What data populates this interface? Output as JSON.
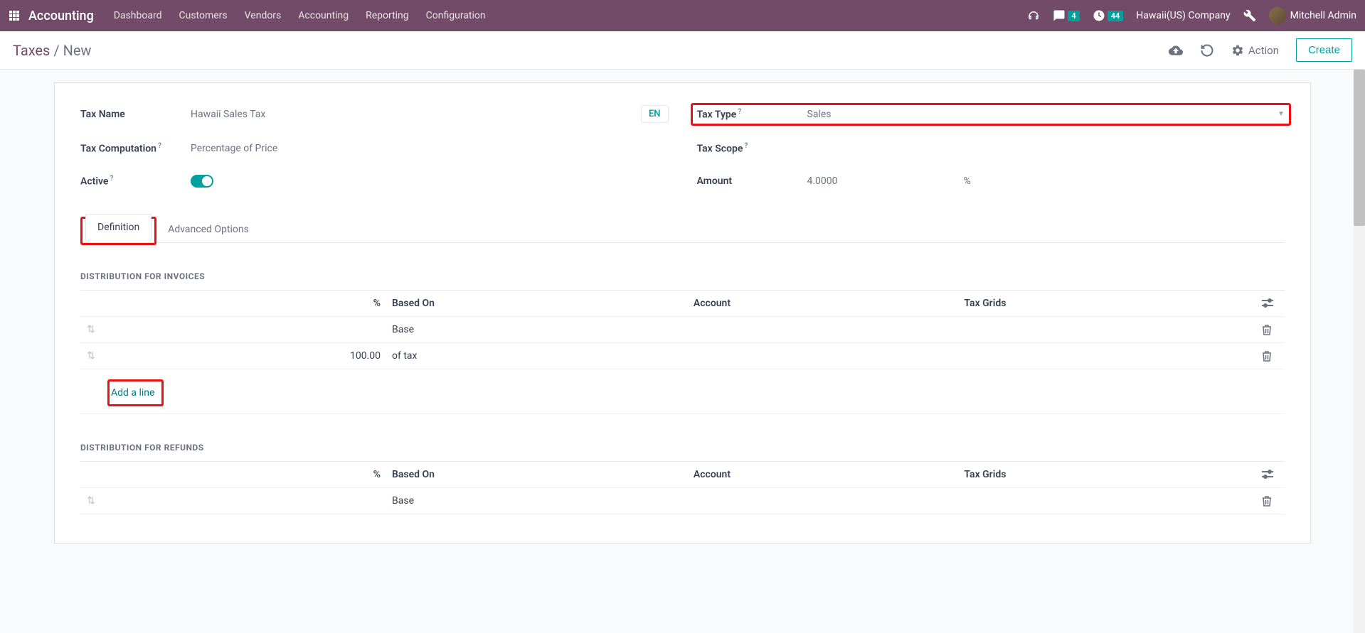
{
  "topbar": {
    "brand": "Accounting",
    "nav": [
      "Dashboard",
      "Customers",
      "Vendors",
      "Accounting",
      "Reporting",
      "Configuration"
    ],
    "messages_badge": "4",
    "activities_badge": "44",
    "company": "Hawaii(US) Company",
    "user": "Mitchell Admin"
  },
  "subbar": {
    "crumb_root": "Taxes",
    "crumb_current": "New",
    "action_label": "Action",
    "create_label": "Create"
  },
  "form": {
    "tax_name_label": "Tax Name",
    "tax_name": "Hawaii Sales Tax",
    "lang": "EN",
    "tax_computation_label": "Tax Computation",
    "tax_computation": "Percentage of Price",
    "active_label": "Active",
    "tax_type_label": "Tax Type",
    "tax_type": "Sales",
    "tax_scope_label": "Tax Scope",
    "amount_label": "Amount",
    "amount": "4.0000",
    "amount_unit": "%"
  },
  "tabs": {
    "definition": "Definition",
    "advanced": "Advanced Options"
  },
  "invoices": {
    "title": "DISTRIBUTION FOR INVOICES",
    "cols": {
      "pct": "%",
      "based_on": "Based On",
      "account": "Account",
      "grids": "Tax Grids"
    },
    "rows": [
      {
        "pct": "",
        "based_on": "Base"
      },
      {
        "pct": "100.00",
        "based_on": "of tax"
      }
    ],
    "add_line": "Add a line"
  },
  "refunds": {
    "title": "DISTRIBUTION FOR REFUNDS",
    "cols": {
      "pct": "%",
      "based_on": "Based On",
      "account": "Account",
      "grids": "Tax Grids"
    },
    "rows": [
      {
        "pct": "",
        "based_on": "Base"
      }
    ]
  }
}
